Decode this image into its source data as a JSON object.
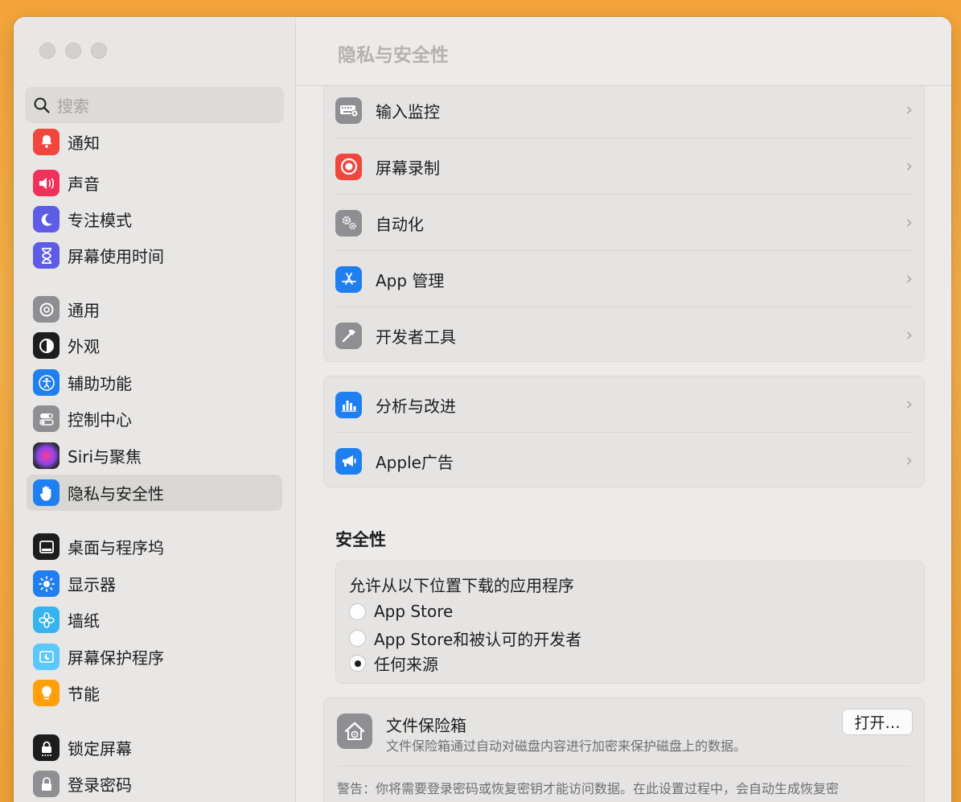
{
  "window": {
    "title": "隐私与安全性"
  },
  "search": {
    "placeholder": "搜索"
  },
  "sidebar": {
    "items": [
      {
        "label": "通知",
        "icon": "bell-icon",
        "color": "#f1463d"
      },
      {
        "label": "声音",
        "icon": "speaker-icon",
        "color": "#f0315a"
      },
      {
        "label": "专注模式",
        "icon": "moon-icon",
        "color": "#5e5ce6"
      },
      {
        "label": "屏幕使用时间",
        "icon": "hourglass-icon",
        "color": "#5e5ce6"
      },
      {
        "label": "通用",
        "icon": "gear-icon",
        "color": "#8e8e93"
      },
      {
        "label": "外观",
        "icon": "appearance-icon",
        "color": "#1d1d1f"
      },
      {
        "label": "辅助功能",
        "icon": "accessibility-icon",
        "color": "#1f7ff0"
      },
      {
        "label": "控制中心",
        "icon": "toggles-icon",
        "color": "#8e8e93"
      },
      {
        "label": "Siri与聚焦",
        "icon": "siri-icon",
        "color": "#3a3a3c"
      },
      {
        "label": "隐私与安全性",
        "icon": "hand-icon",
        "color": "#1f7ff0",
        "selected": true
      },
      {
        "label": "桌面与程序坞",
        "icon": "dock-icon",
        "color": "#1d1d1f"
      },
      {
        "label": "显示器",
        "icon": "sun-icon",
        "color": "#1f7ff0"
      },
      {
        "label": "墙纸",
        "icon": "flower-icon",
        "color": "#36b3f0"
      },
      {
        "label": "屏幕保护程序",
        "icon": "screensaver-icon",
        "color": "#5ac8fa"
      },
      {
        "label": "节能",
        "icon": "bulb-icon",
        "color": "#ff9f0a"
      },
      {
        "label": "锁定屏幕",
        "icon": "lock-screen-icon",
        "color": "#1d1d1f"
      },
      {
        "label": "登录密码",
        "icon": "lock-icon",
        "color": "#8e8e93"
      }
    ]
  },
  "main": {
    "card1": {
      "rows": [
        {
          "label": "输入监控",
          "icon": "keyboard-icon",
          "color": "#8e8e93"
        },
        {
          "label": "屏幕录制",
          "icon": "record-icon",
          "color": "#f1463d"
        },
        {
          "label": "自动化",
          "icon": "gears-icon",
          "color": "#8e8e93"
        },
        {
          "label": "App 管理",
          "icon": "app-store-icon",
          "color": "#1f7ff0"
        },
        {
          "label": "开发者工具",
          "icon": "hammer-icon",
          "color": "#8e8e93"
        }
      ]
    },
    "card2": {
      "rows": [
        {
          "label": "分析与改进",
          "icon": "bar-chart-icon",
          "color": "#1f7ff0"
        },
        {
          "label": "Apple广告",
          "icon": "megaphone-icon",
          "color": "#1f7ff0"
        }
      ]
    },
    "security": {
      "title": "安全性",
      "download_title": "允许从以下位置下载的应用程序",
      "options": [
        {
          "label": "App Store",
          "selected": false
        },
        {
          "label": "App Store和被认可的开发者",
          "selected": false
        },
        {
          "label": "任何来源",
          "selected": true
        }
      ]
    },
    "filevault": {
      "title": "文件保险箱",
      "description": "文件保险箱通过自动对磁盘内容进行加密来保护磁盘上的数据。",
      "button": "打开…",
      "warning": "警告：你将需要登录密码或恢复密钥才能访问数据。在此设置过程中，会自动生成恢复密"
    }
  }
}
